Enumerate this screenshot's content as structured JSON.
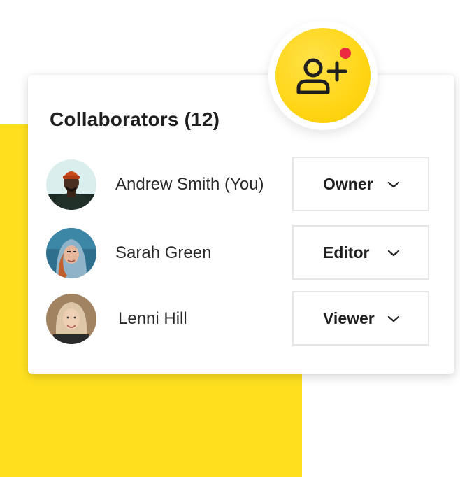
{
  "panel": {
    "title": "Collaborators (12)"
  },
  "collaborators": [
    {
      "name": "Andrew Smith (You)",
      "role": "Owner",
      "avatar": "andrew-avatar"
    },
    {
      "name": "Sarah Green",
      "role": "Editor",
      "avatar": "sarah-avatar"
    },
    {
      "name": "Lenni Hill",
      "role": "Viewer",
      "avatar": "lenni-avatar"
    }
  ],
  "add_collaborator": {
    "icon": "add-user-icon",
    "notification": true
  },
  "colors": {
    "accent_yellow": "#ffe01f",
    "notification_red": "#ea2b3d",
    "text_dark": "#1f1f1f",
    "border": "#e6e6e6"
  }
}
